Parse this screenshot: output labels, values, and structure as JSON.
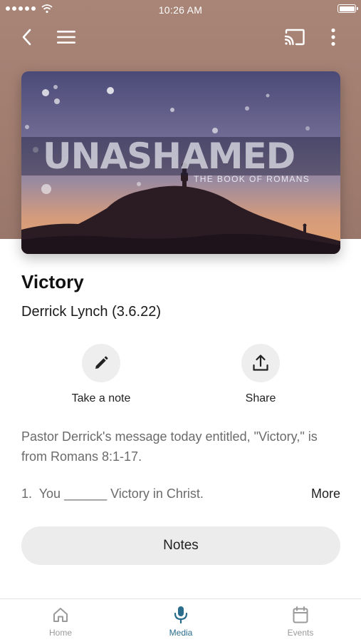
{
  "status_bar": {
    "time": "10:26 AM"
  },
  "toolbar": {
    "back_icon": "chevron-left-icon",
    "menu_icon": "hamburger-menu-icon",
    "cast_icon": "cast-icon",
    "overflow_icon": "vertical-dots-icon"
  },
  "artwork": {
    "title": "UNASHAMED",
    "subtitle": "THE BOOK OF ROMANS"
  },
  "episode": {
    "title": "Victory",
    "speaker": "Derrick Lynch (3.6.22)"
  },
  "actions": {
    "note_label": "Take a note",
    "note_icon": "pencil-icon",
    "share_label": "Share",
    "share_icon": "share-upload-icon"
  },
  "description": "Pastor Derrick's message today entitled, \"Victory,\" is from Romans 8:1-17.",
  "notes_preview": {
    "line": "1.  You ______ Victory in Christ.",
    "more_label": "More"
  },
  "notes_button_label": "Notes",
  "tabs": [
    {
      "label": "Home",
      "icon": "home-icon",
      "active": false
    },
    {
      "label": "Media",
      "icon": "microphone-icon",
      "active": true
    },
    {
      "label": "Events",
      "icon": "calendar-icon",
      "active": false
    }
  ],
  "colors": {
    "header_bg": "#a17d70",
    "accent": "#2a6c8c",
    "inactive_tab": "#9a9a9a"
  }
}
